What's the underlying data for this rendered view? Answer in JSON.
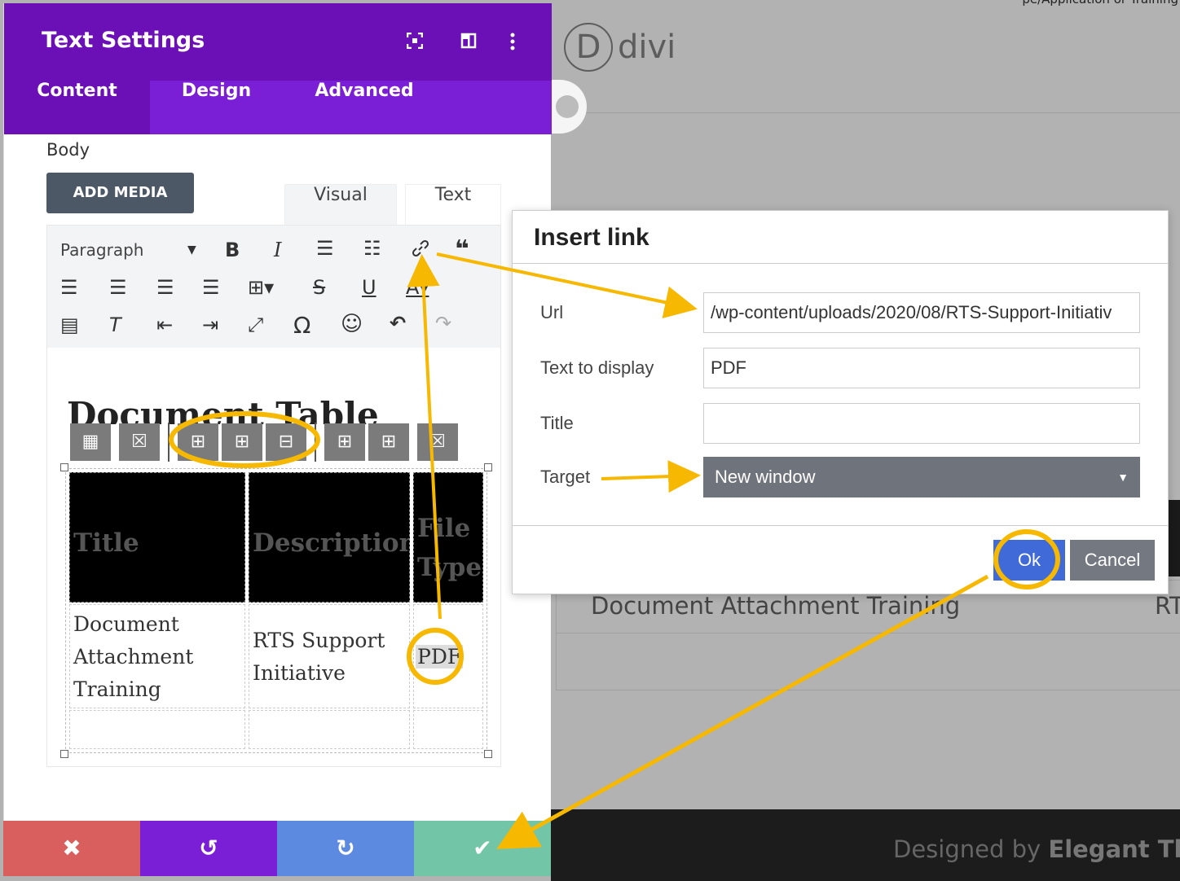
{
  "background": {
    "top_text": "pe/Application or Training",
    "logo_text": "divi",
    "logo_letter": "D",
    "row_text": "Document Attachment Training",
    "row_right": "RT",
    "footer_prefix": "Designed by ",
    "footer_brand": "Elegant The"
  },
  "panel": {
    "title": "Text Settings",
    "header_icons": [
      "focus-icon",
      "columns-icon",
      "more-icon"
    ],
    "tabs": [
      "Content",
      "Design",
      "Advanced"
    ],
    "active_tab": "Content",
    "body_label": "Body",
    "add_media_label": "ADD MEDIA",
    "editor_tabs": [
      "Visual",
      "Text"
    ],
    "paragraph_label": "Paragraph",
    "heading": "Document Table",
    "table": {
      "headers": [
        "Title",
        "Description",
        "File Type"
      ],
      "rows": [
        [
          "Document Attachment Training",
          "RTS Support Initiative",
          "PDF"
        ]
      ]
    }
  },
  "modal": {
    "title": "Insert link",
    "url_label": "Url",
    "url_value": "/wp-content/uploads/2020/08/RTS-Support-Initiativ",
    "text_label": "Text to display",
    "text_value": "PDF",
    "title_label": "Title",
    "title_value": "",
    "target_label": "Target",
    "target_value": "New window",
    "ok_label": "Ok",
    "cancel_label": "Cancel"
  },
  "colors": {
    "panel_header": "#6b0fb6",
    "panel_tabs": "#7b1fd6",
    "annotation": "#f6b800",
    "discard": "#d95f5f",
    "undo": "#7b1fd6",
    "redo": "#5b8ae0",
    "save": "#72c5a7",
    "ok": "#3f6ad8"
  }
}
